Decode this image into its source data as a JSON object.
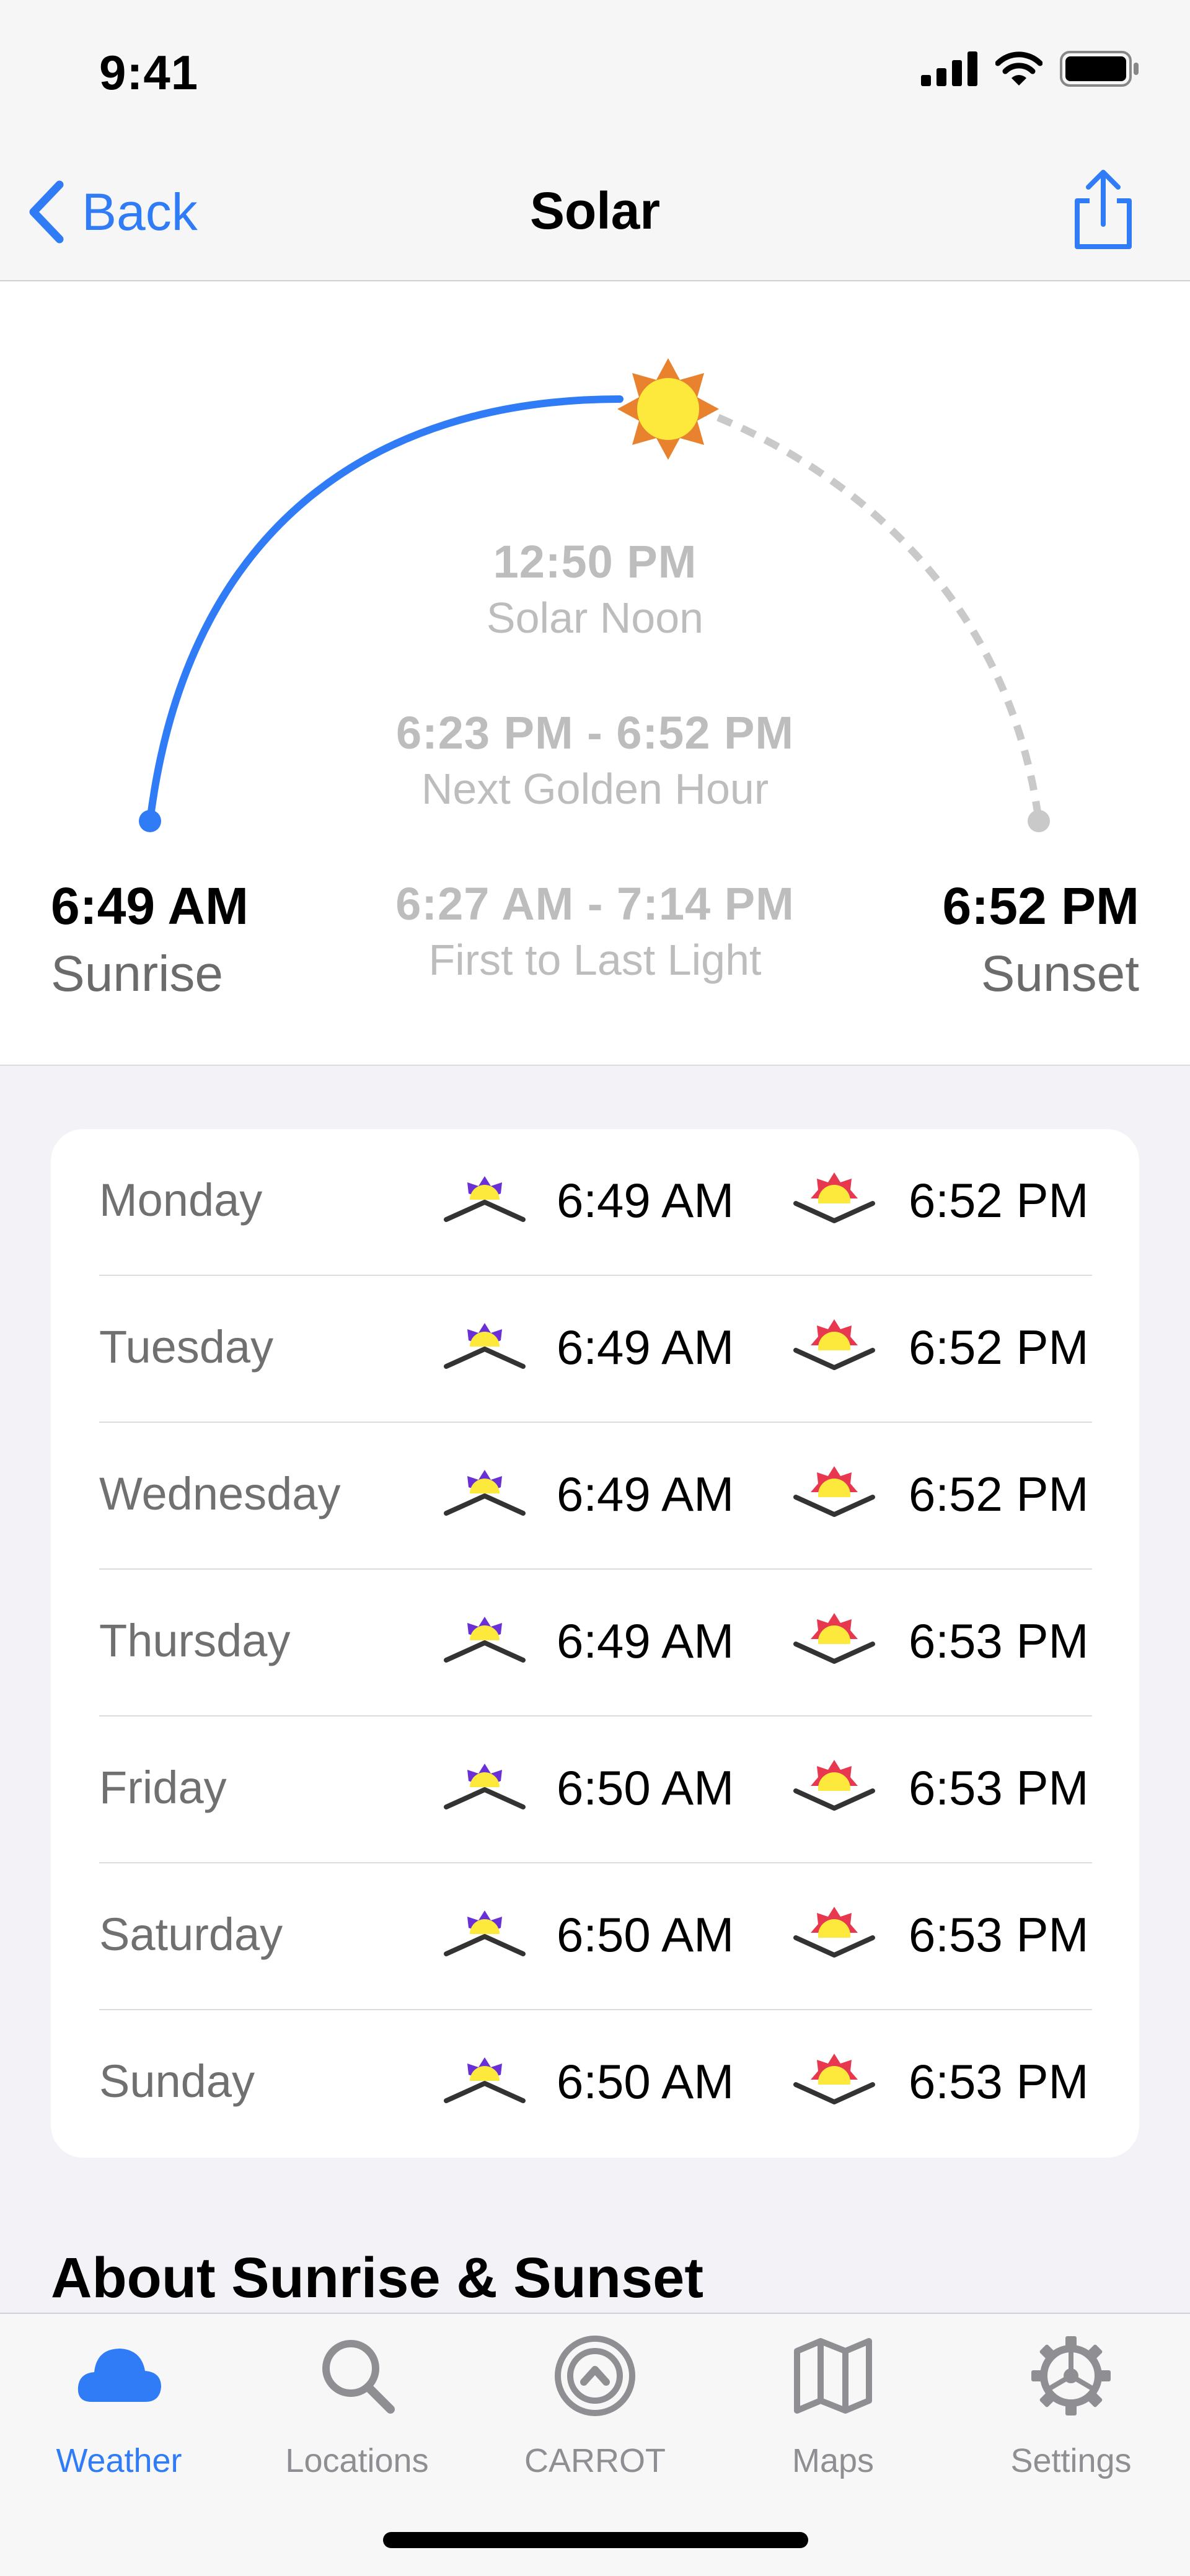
{
  "status_bar": {
    "time": "9:41"
  },
  "nav": {
    "back_label": "Back",
    "title": "Solar"
  },
  "solar": {
    "solar_noon": {
      "time": "12:50 PM",
      "label": "Solar Noon"
    },
    "golden_hour": {
      "time": "6:23 PM - 6:52 PM",
      "label": "Next Golden Hour"
    },
    "first_last_light": {
      "time": "6:27 AM - 7:14 PM",
      "label": "First to Last Light"
    },
    "sunrise": {
      "time": "6:49 AM",
      "label": "Sunrise"
    },
    "sunset": {
      "time": "6:52 PM",
      "label": "Sunset"
    }
  },
  "week": [
    {
      "day": "Monday",
      "sunrise": "6:49 AM",
      "sunset": "6:52 PM"
    },
    {
      "day": "Tuesday",
      "sunrise": "6:49 AM",
      "sunset": "6:52 PM"
    },
    {
      "day": "Wednesday",
      "sunrise": "6:49 AM",
      "sunset": "6:52 PM"
    },
    {
      "day": "Thursday",
      "sunrise": "6:49 AM",
      "sunset": "6:53 PM"
    },
    {
      "day": "Friday",
      "sunrise": "6:50 AM",
      "sunset": "6:53 PM"
    },
    {
      "day": "Saturday",
      "sunrise": "6:50 AM",
      "sunset": "6:53 PM"
    },
    {
      "day": "Sunday",
      "sunrise": "6:50 AM",
      "sunset": "6:53 PM"
    }
  ],
  "about": {
    "title": "About Sunrise & Sunset"
  },
  "tabs": [
    {
      "label": "Weather",
      "icon": "cloud-icon",
      "active": true
    },
    {
      "label": "Locations",
      "icon": "search-icon",
      "active": false
    },
    {
      "label": "CARROT",
      "icon": "carrot-icon",
      "active": false
    },
    {
      "label": "Maps",
      "icon": "map-icon",
      "active": false
    },
    {
      "label": "Settings",
      "icon": "gear-icon",
      "active": false
    }
  ],
  "colors": {
    "accent": "#2f7cf6",
    "sun_orange": "#e8822f",
    "sun_yellow": "#fde93b",
    "sunrise_purple": "#6a2fd6",
    "sunset_red": "#e8384f"
  }
}
